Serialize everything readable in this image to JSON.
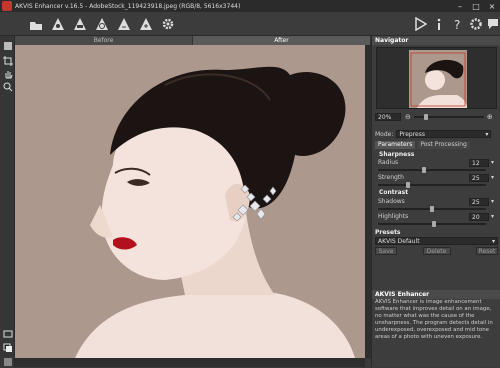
{
  "window": {
    "title": "AKVIS Enhancer v.16.5 - AdobeStock_119423918.jpeg (RGB/8, 5616x3744)"
  },
  "toolbar": {
    "icons": [
      "open-icon",
      "save-icon",
      "print-icon",
      "batch-icon",
      "before-icon",
      "after-icon",
      "settings-icon"
    ],
    "right_icons": [
      "run-icon",
      "info-icon",
      "help-icon",
      "preferences-icon",
      "feedback-icon"
    ]
  },
  "tabs": {
    "before": "Before",
    "after": "After"
  },
  "navigator": {
    "title": "Navigator",
    "zoom": "20%"
  },
  "mode": {
    "label": "Mode:",
    "value": "Prepress"
  },
  "params": {
    "tab_parameters": "Parameters",
    "tab_post": "Post Processing",
    "sharpness": "Sharpness",
    "radius_label": "Radius",
    "radius_value": "12",
    "strength_label": "Strength",
    "strength_value": "25",
    "contrast": "Contrast",
    "shadows_label": "Shadows",
    "shadows_value": "25",
    "highlights_label": "Highlights",
    "highlights_value": "20"
  },
  "presets": {
    "title": "Presets",
    "value": "AKVIS Default",
    "save": "Save",
    "delete": "Delete",
    "reset": "Reset"
  },
  "info": {
    "title": "AKVIS Enhancer",
    "text": "AKVIS Enhancer is image enhancement software that improves detail on an image, no matter what was the cause of the unsharpness. The program detects detail in underexposed, overexposed and mid tone areas of a photo with uneven exposure."
  },
  "colors": {
    "accent": "#c0392b",
    "panel": "#3d3d3d"
  }
}
